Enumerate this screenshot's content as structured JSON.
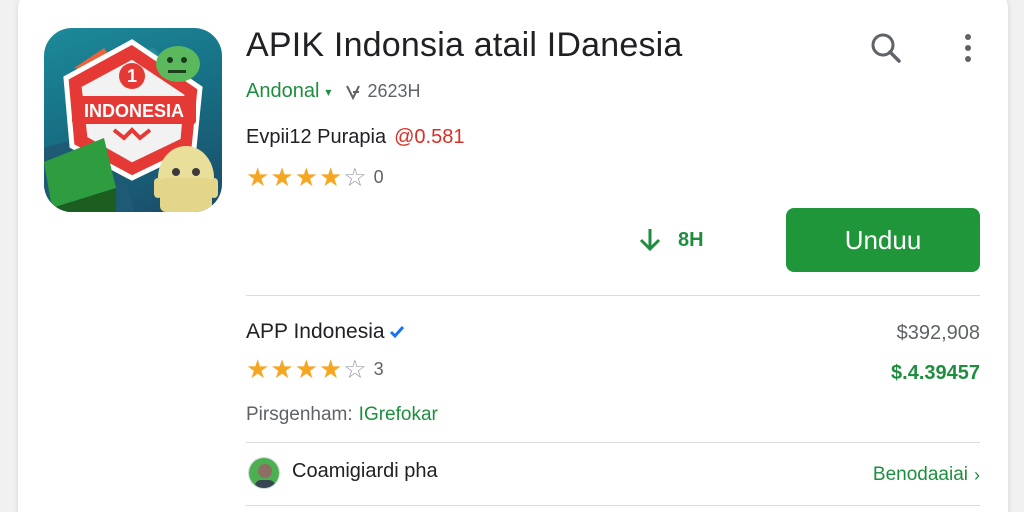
{
  "app": {
    "title": "APIK Indonsia atail IDanesia",
    "icon_text_badge": "1",
    "icon_text_main": "INDONESIA"
  },
  "developer": {
    "name": "Andonal",
    "count": "2623H"
  },
  "meta": {
    "label": "Evpii12 Purapia",
    "price": "@0.581"
  },
  "rating_top": {
    "stars": 4,
    "max": 5,
    "count": "0"
  },
  "download": {
    "size": "8H",
    "install_label": "Unduu"
  },
  "related": {
    "name": "APP Indonesia",
    "stars": 4,
    "max": 5,
    "count": "3",
    "price_a": "$392,908",
    "price_b": "$.4.39457",
    "publisher_label": "Pirsgenham:",
    "publisher_value": "IGrefokar"
  },
  "comment": {
    "text": "Coamigiardi pha",
    "see_more": "Benodaaiai"
  },
  "colors": {
    "accent_green": "#1e9639",
    "link_green": "#1e8e3e",
    "price_red": "#d93025",
    "star": "#f5a623"
  },
  "icons": {
    "search": "search-icon",
    "more": "more-vert-icon",
    "download": "download-arrow-icon",
    "verified": "verified-check-icon",
    "chevron": "chevron-right-icon"
  }
}
